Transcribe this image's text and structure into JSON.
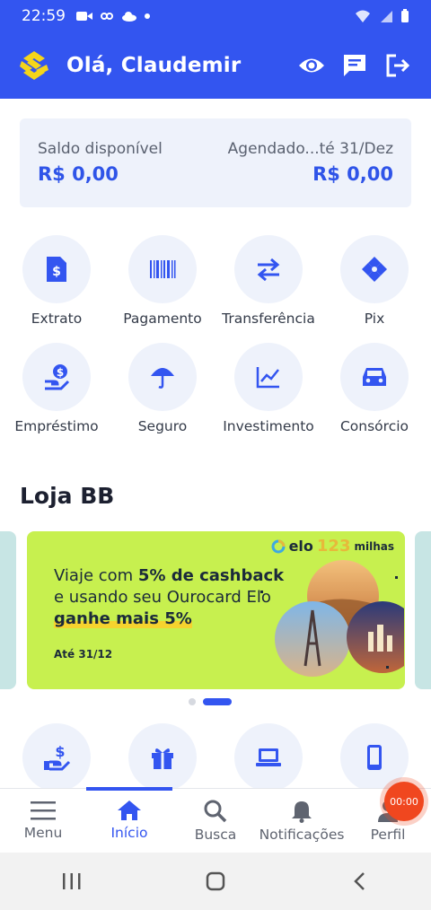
{
  "statusbar": {
    "time": "22:59"
  },
  "header": {
    "greeting": "Olá, Claudemir"
  },
  "balance": {
    "available_label": "Saldo disponível",
    "available_value": "R$ 0,00",
    "scheduled_label": "Agendado...té 31/Dez",
    "scheduled_value": "R$ 0,00"
  },
  "shortcuts_row1": [
    {
      "label": "Extrato",
      "icon": "statement-icon"
    },
    {
      "label": "Pagamento",
      "icon": "barcode-icon"
    },
    {
      "label": "Transferência",
      "icon": "transfer-arrows-icon"
    },
    {
      "label": "Pix",
      "icon": "pix-icon"
    }
  ],
  "shortcuts_row2": [
    {
      "label": "Empréstimo",
      "icon": "loan-icon"
    },
    {
      "label": "Seguro",
      "icon": "umbrella-icon"
    },
    {
      "label": "Investimento",
      "icon": "chart-icon"
    },
    {
      "label": "Consórcio",
      "icon": "car-icon"
    }
  ],
  "loja": {
    "title": "Loja BB",
    "banner": {
      "line1_pre": "Viaje com ",
      "line1_bold": "5% de cashback",
      "line2": "e usando seu Ourocard Elo",
      "line3": "ganhe mais 5%",
      "date": "Até 31/12",
      "brand_elo": "elo",
      "brand_123": "123",
      "brand_milhas": "milhas"
    }
  },
  "carousel": {
    "slide_count": 2,
    "active_index": 1
  },
  "shortcuts_row3": [
    {
      "icon": "hand-money-icon"
    },
    {
      "icon": "gift-icon"
    },
    {
      "icon": "laptop-icon"
    },
    {
      "icon": "phone-icon"
    }
  ],
  "bottom_nav": [
    {
      "label": "Menu",
      "icon": "menu-icon"
    },
    {
      "label": "Início",
      "icon": "home-icon",
      "active": true
    },
    {
      "label": "Busca",
      "icon": "search-icon"
    },
    {
      "label": "Notificações",
      "icon": "bell-icon"
    },
    {
      "label": "Perfil",
      "icon": "profile-icon"
    }
  ],
  "recording": {
    "timer": "00:00"
  },
  "colors": {
    "primary": "#3355f0",
    "banner_bg": "#c7f04f",
    "highlight": "#f6d32e",
    "card_bg": "#eef2fb"
  }
}
